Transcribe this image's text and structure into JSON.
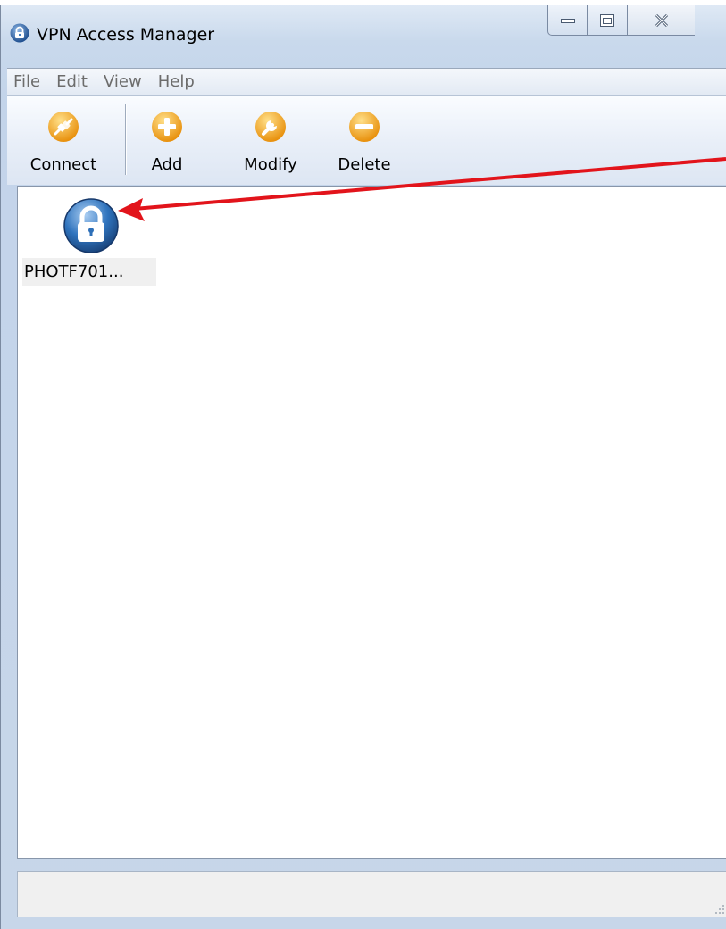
{
  "window": {
    "title": "VPN Access Manager",
    "title_icon": "padlock-icon"
  },
  "menu": {
    "items": [
      "File",
      "Edit",
      "View",
      "Help"
    ]
  },
  "toolbar": {
    "connect_label": "Connect",
    "add_label": "Add",
    "modify_label": "Modify",
    "delete_label": "Delete",
    "icons": {
      "connect": "connect-plug-icon",
      "add": "plus-icon",
      "modify": "wrench-icon",
      "delete": "minus-icon"
    }
  },
  "connections": [
    {
      "label": "PHOTF701...",
      "icon": "padlock-icon"
    }
  ],
  "colors": {
    "accent_orange": "#f4a81e",
    "lock_blue": "#2d6fb8",
    "annotation_red": "#e2141b"
  }
}
